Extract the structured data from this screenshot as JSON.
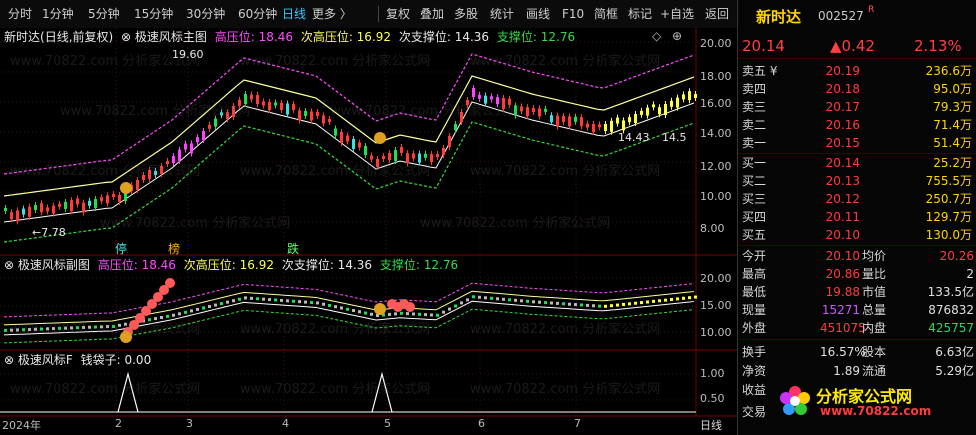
{
  "toolbar": {
    "left": [
      "分时",
      "1分钟",
      "5分钟",
      "15分钟",
      "30分钟",
      "60分钟",
      "日线",
      "更多 〉"
    ],
    "right": [
      "复权",
      "叠加",
      "多股",
      "统计",
      "画线",
      "F10",
      "简框",
      "标记",
      "+自选",
      "返回"
    ]
  },
  "main": {
    "name": "新时达",
    "mode": "(日线,前复权)",
    "indicator": "极速风标主图",
    "hi_label": "高压位: 18.46",
    "hi2_label": "次高压位: 16.92",
    "sup2_label": "次支撑位: 14.36",
    "sup_label": "支撑位: 12.76",
    "yaxis": [
      "20.00",
      "18.00",
      "16.00",
      "14.00",
      "12.00",
      "10.00",
      "8.00"
    ],
    "ann_high": "19.60",
    "ann_low": "←7.78",
    "ann_mid1": "14.43",
    "ann_mid2": "14.5",
    "markers": [
      "停",
      "榜",
      "跌"
    ]
  },
  "sub1": {
    "title": "极速风标副图",
    "hi_label": "高压位: 18.46",
    "hi2_label": "次高压位: 16.92",
    "sup2_label": "次支撑位: 14.36",
    "sup_label": "支撑位: 12.76",
    "yaxis": [
      "20.00",
      "15.00",
      "10.00"
    ]
  },
  "sub2": {
    "title": "极速风标F",
    "value": "钱袋子: 0.00",
    "yaxis": [
      "1.00",
      "0.50"
    ]
  },
  "xaxis": {
    "labels": [
      "2024年",
      "2",
      "3",
      "4",
      "5",
      "6",
      "7"
    ],
    "period": "日线"
  },
  "quote": {
    "name": "新时达",
    "code": "002527",
    "tag": "R",
    "price": "20.14",
    "change": "▲0.42",
    "pct": "2.13%",
    "asks": [
      {
        "k": "卖五 ¥",
        "p": "20.19",
        "q": "236.6万"
      },
      {
        "k": "卖四",
        "p": "20.18",
        "q": "95.0万"
      },
      {
        "k": "卖三",
        "p": "20.17",
        "q": "79.3万"
      },
      {
        "k": "卖二",
        "p": "20.16",
        "q": "71.4万"
      },
      {
        "k": "卖一",
        "p": "20.15",
        "q": "51.4万"
      }
    ],
    "bids": [
      {
        "k": "买一",
        "p": "20.14",
        "q": "25.2万"
      },
      {
        "k": "买二",
        "p": "20.13",
        "q": "755.5万"
      },
      {
        "k": "买三",
        "p": "20.12",
        "q": "250.7万"
      },
      {
        "k": "买四",
        "p": "20.11",
        "q": "129.7万"
      },
      {
        "k": "买五",
        "p": "20.10",
        "q": "130.0万"
      }
    ],
    "stats": [
      {
        "k": "今开",
        "v": "20.10",
        "k2": "均价",
        "v2": "20.26"
      },
      {
        "k": "最高",
        "v": "20.86",
        "k2": "量比",
        "v2": "2"
      },
      {
        "k": "最低",
        "v": "19.88",
        "k2": "市值",
        "v2": "133.5亿"
      },
      {
        "k": "现量",
        "v": "15271",
        "k2": "总量",
        "v2": "876832"
      },
      {
        "k": "外盘",
        "v": "451075",
        "k2": "内盘",
        "v2": "425757"
      }
    ],
    "stats2": [
      {
        "k": "换手",
        "v": "16.57%",
        "k2": "股本",
        "v2": "6.63亿"
      },
      {
        "k": "净资",
        "v": "1.89",
        "k2": "流通",
        "v2": "5.29亿"
      },
      {
        "k": "收益",
        "v": "",
        "k2": "",
        "v2": ""
      },
      {
        "k": "交易",
        "v": "",
        "k2": "",
        "v2": ""
      }
    ],
    "logo_text": "分析家公式网",
    "logo_url": "www.70822.com"
  },
  "watermark": "www.70822.com 分析家公式网",
  "colors": {
    "up": "#ff3b3b",
    "down": "#22dd55",
    "band_top": "#ff4cff",
    "band_mid": "#ffff99",
    "band_bot": "#33dd33"
  }
}
